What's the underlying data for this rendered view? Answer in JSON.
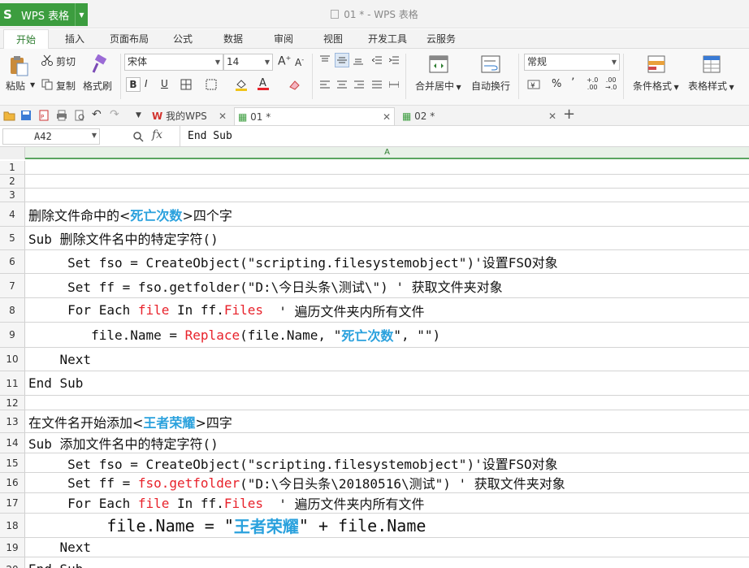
{
  "app": {
    "logo": "S",
    "name": "WPS 表格",
    "doc_title": "01 * - WPS 表格"
  },
  "tabs": [
    "开始",
    "插入",
    "页面布局",
    "公式",
    "数据",
    "审阅",
    "视图",
    "开发工具",
    "云服务"
  ],
  "ribbon": {
    "paste": "粘贴",
    "cut": "剪切",
    "copy": "复制",
    "format_painter": "格式刷",
    "font_name": "宋体",
    "font_size": "14",
    "bold": "B",
    "italic": "I",
    "underline": "U",
    "merge": "合并居中",
    "wrap": "自动换行",
    "number_format": "常规",
    "percent": "%",
    "comma": "’",
    "cond_format": "条件格式",
    "table_style": "表格样式"
  },
  "doc_tabs": [
    "我的WPS",
    "01 *",
    "02 *"
  ],
  "formula_bar": {
    "cell_ref": "A42",
    "fx": "fx",
    "content": "End Sub"
  },
  "column_header": "A",
  "rows": [
    {
      "n": "1",
      "segs": []
    },
    {
      "n": "2",
      "segs": []
    },
    {
      "n": "3",
      "segs": []
    },
    {
      "n": "4",
      "segs": [
        {
          "t": "删除文件命中的<"
        },
        {
          "t": "死亡次数",
          "c": "blue"
        },
        {
          "t": ">四个字"
        }
      ]
    },
    {
      "n": "5",
      "segs": [
        {
          "t": "Sub 删除文件名中的特定字符()"
        }
      ]
    },
    {
      "n": "6",
      "segs": [
        {
          "t": "     Set fso = CreateObject(\"scripting.filesystemobject\")'设置FSO对象"
        }
      ]
    },
    {
      "n": "7",
      "segs": [
        {
          "t": "     Set ff = fso.getfolder(\"D:\\今日头条\\测试\\\") ' 获取文件夹对象"
        }
      ]
    },
    {
      "n": "8",
      "segs": [
        {
          "t": "     For Each "
        },
        {
          "t": "file",
          "c": "red"
        },
        {
          "t": " In ff."
        },
        {
          "t": "Files",
          "c": "red"
        },
        {
          "t": "  ' 遍历文件夹内所有文件"
        }
      ]
    },
    {
      "n": "9",
      "segs": [
        {
          "t": "        file.Name = "
        },
        {
          "t": "Replace",
          "c": "red"
        },
        {
          "t": "(file.Name, \""
        },
        {
          "t": "死亡次数",
          "c": "blue"
        },
        {
          "t": "\", \"\")"
        }
      ]
    },
    {
      "n": "10",
      "segs": [
        {
          "t": "    Next"
        }
      ]
    },
    {
      "n": "11",
      "segs": [
        {
          "t": "End Sub"
        }
      ]
    },
    {
      "n": "12",
      "segs": []
    },
    {
      "n": "13",
      "segs": [
        {
          "t": "在文件名开始添加<"
        },
        {
          "t": "王者荣耀",
          "c": "blue"
        },
        {
          "t": ">四字"
        }
      ]
    },
    {
      "n": "14",
      "segs": [
        {
          "t": "Sub 添加文件名中的特定字符()"
        }
      ]
    },
    {
      "n": "15",
      "segs": [
        {
          "t": "     Set fso = CreateObject(\"scripting.filesystemobject\")'设置FSO对象"
        }
      ]
    },
    {
      "n": "16",
      "segs": [
        {
          "t": "     Set ff = "
        },
        {
          "t": "fso.getfolder",
          "c": "red"
        },
        {
          "t": "(\"D:\\今日头条\\20180516\\测试\") ' 获取文件夹对象"
        }
      ]
    },
    {
      "n": "17",
      "segs": [
        {
          "t": "     For Each "
        },
        {
          "t": "file",
          "c": "red"
        },
        {
          "t": " In ff."
        },
        {
          "t": "Files",
          "c": "red"
        },
        {
          "t": "  ' 遍历文件夹内所有文件"
        }
      ]
    },
    {
      "n": "18",
      "segs": [
        {
          "t": "        file.Name = \""
        },
        {
          "t": "王者荣耀",
          "c": "blue"
        },
        {
          "t": "\" + file.Name"
        }
      ]
    },
    {
      "n": "19",
      "segs": [
        {
          "t": "    Next"
        }
      ]
    },
    {
      "n": "20",
      "segs": [
        {
          "t": "End Sub"
        }
      ]
    }
  ]
}
